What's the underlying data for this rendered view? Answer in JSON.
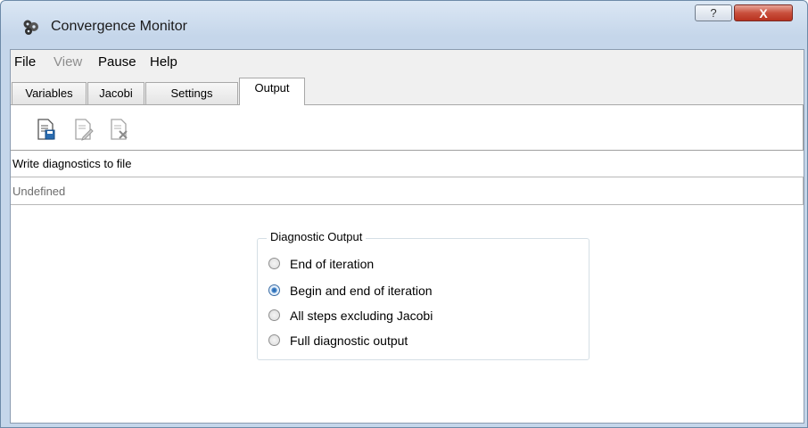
{
  "window": {
    "title": "Convergence Monitor",
    "help_glyph": "?",
    "close_glyph": "X"
  },
  "menu": {
    "items": [
      "File",
      "View",
      "Pause",
      "Help"
    ],
    "disabled": [
      "View"
    ]
  },
  "tabs": [
    "Variables",
    "Jacobi",
    "Settings",
    "Output"
  ],
  "active_tab": "Output",
  "toolbar": {
    "icons": [
      "new-file-icon",
      "edit-file-icon",
      "delete-file-icon"
    ]
  },
  "output": {
    "write_label": "Write diagnostics to file",
    "file_value": "Undefined",
    "group_title": "Diagnostic Output",
    "options": [
      "End of iteration",
      "Begin and end of iteration",
      "All steps excluding Jacobi",
      "Full diagnostic output"
    ],
    "selected": "Begin and end of iteration"
  },
  "colors": {
    "accent": "#1d5da8",
    "close": "#c9503d"
  }
}
